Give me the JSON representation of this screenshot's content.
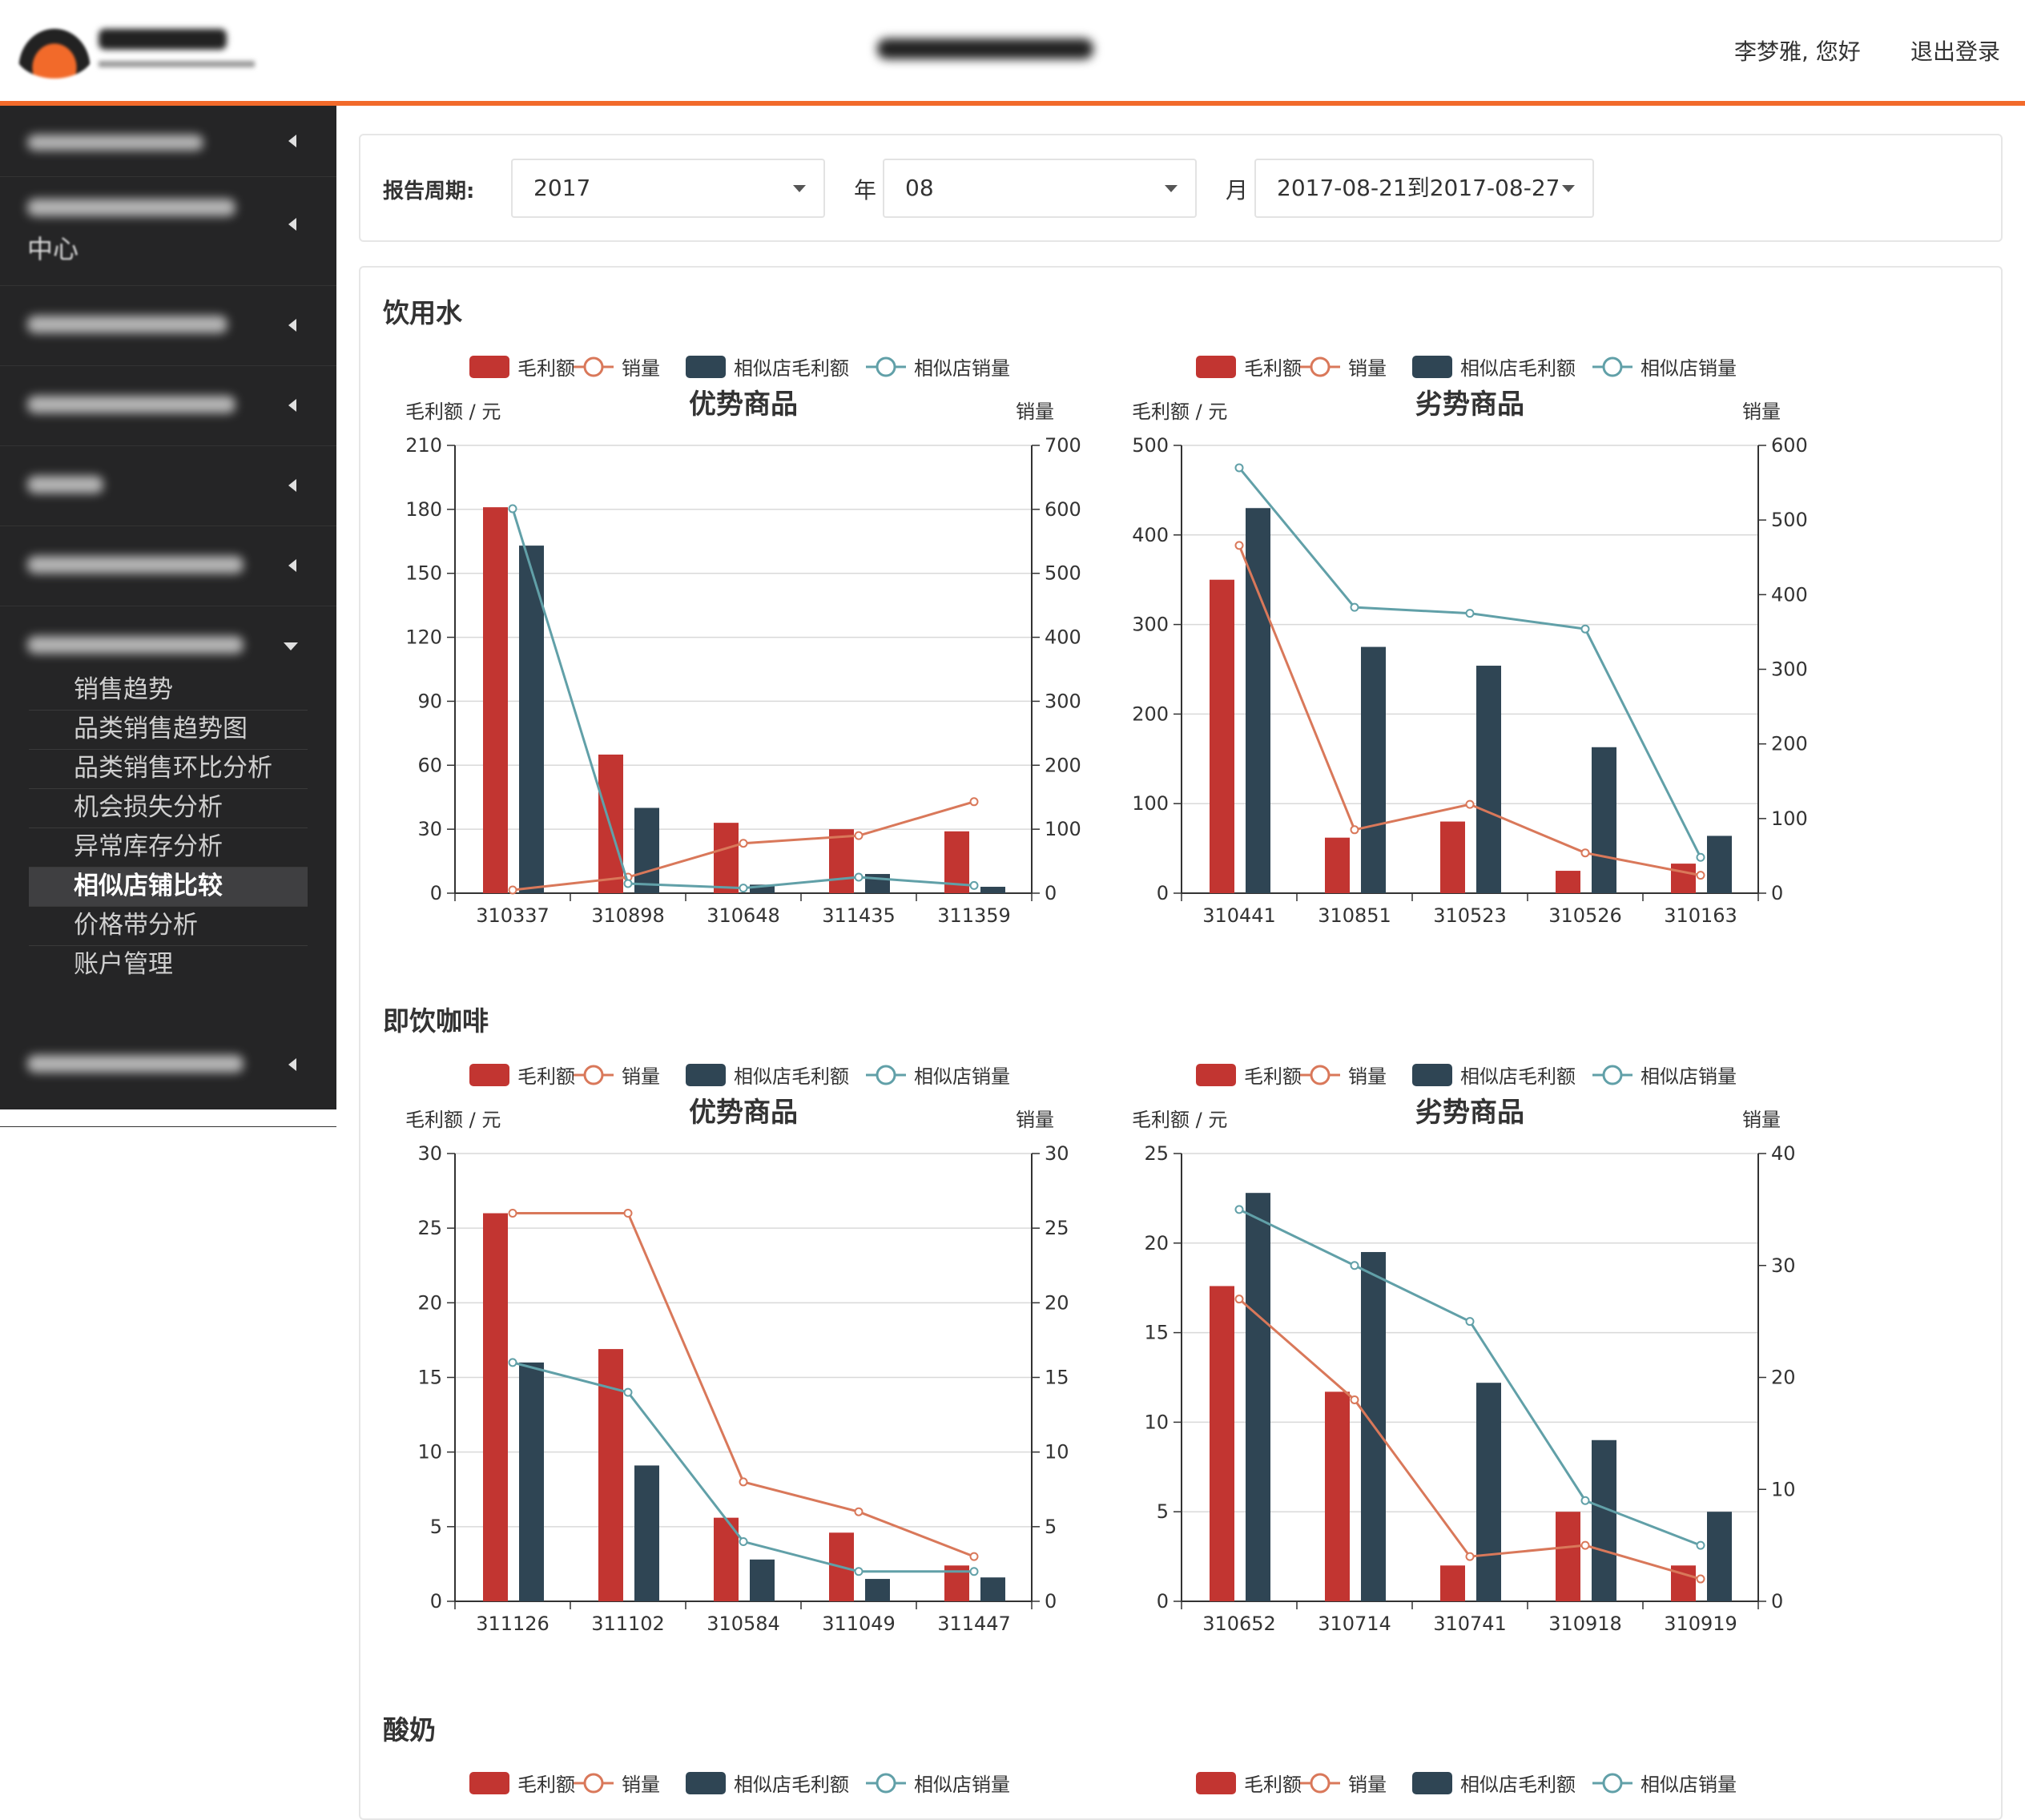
{
  "header": {
    "greeting": "李梦雅, 您好",
    "logout": "退出登录"
  },
  "sidebar": {
    "submenu": [
      {
        "label": "销售趋势",
        "active": false
      },
      {
        "label": "品类销售趋势图",
        "active": false
      },
      {
        "label": "品类销售环比分析",
        "active": false
      },
      {
        "label": "机会损失分析",
        "active": false
      },
      {
        "label": "异常库存分析",
        "active": false
      },
      {
        "label": "相似店铺比较",
        "active": true
      },
      {
        "label": "价格带分析",
        "active": false
      },
      {
        "label": "账户管理",
        "active": false
      }
    ],
    "second_item_text": "中心"
  },
  "filters": {
    "period_label": "报告周期:",
    "year": "2017",
    "year_unit": "年",
    "month": "08",
    "month_unit": "月",
    "week": "2017-08-21到2017-08-27"
  },
  "colors": {
    "profit": "#c23531",
    "sales": "#d9785a",
    "similar_profit": "#2f4554",
    "similar_sales": "#61a0a8",
    "accent": "#f26a2a"
  },
  "legend": [
    "毛利额",
    "销量",
    "相似店毛利额",
    "相似店销量"
  ],
  "axis_labels": {
    "left": "毛利额 / 元",
    "right": "销量"
  },
  "sections": [
    {
      "title": "饮用水"
    },
    {
      "title": "即饮咖啡"
    },
    {
      "title": "酸奶"
    }
  ],
  "chart_data": [
    {
      "type": "bar",
      "section": "饮用水",
      "title": "优势商品",
      "categories": [
        "310337",
        "310898",
        "310648",
        "311435",
        "311359"
      ],
      "ylabel": "毛利额 / 元",
      "ylim": [
        0,
        210
      ],
      "yticks": [
        0,
        30,
        60,
        90,
        120,
        150,
        180,
        210
      ],
      "y2label": "销量",
      "y2lim": [
        0,
        700
      ],
      "y2ticks": [
        0,
        100,
        200,
        300,
        400,
        500,
        600,
        700
      ],
      "series": [
        {
          "name": "毛利额",
          "type": "bar",
          "axis": "left",
          "values": [
            181,
            65,
            33,
            30,
            29
          ]
        },
        {
          "name": "相似店毛利额",
          "type": "bar",
          "axis": "left",
          "values": [
            163,
            40,
            4,
            9,
            3
          ]
        },
        {
          "name": "销量",
          "type": "line",
          "axis": "right",
          "values": [
            5,
            25,
            78,
            90,
            143
          ]
        },
        {
          "name": "相似店销量",
          "type": "line",
          "axis": "right",
          "values": [
            601,
            15,
            8,
            25,
            12
          ]
        }
      ]
    },
    {
      "type": "bar",
      "section": "饮用水",
      "title": "劣势商品",
      "categories": [
        "310441",
        "310851",
        "310523",
        "310526",
        "310163"
      ],
      "ylabel": "毛利额 / 元",
      "ylim": [
        0,
        500
      ],
      "yticks": [
        0,
        100,
        200,
        300,
        400,
        500
      ],
      "y2label": "销量",
      "y2lim": [
        0,
        600
      ],
      "y2ticks": [
        0,
        100,
        200,
        300,
        400,
        500,
        600
      ],
      "series": [
        {
          "name": "毛利额",
          "type": "bar",
          "axis": "left",
          "values": [
            350,
            62,
            80,
            25,
            33
          ]
        },
        {
          "name": "相似店毛利额",
          "type": "bar",
          "axis": "left",
          "values": [
            430,
            275,
            254,
            163,
            64
          ]
        },
        {
          "name": "销量",
          "type": "line",
          "axis": "right",
          "values": [
            466,
            85,
            119,
            54,
            24
          ]
        },
        {
          "name": "相似店销量",
          "type": "line",
          "axis": "right",
          "values": [
            570,
            383,
            375,
            354,
            48
          ]
        }
      ]
    },
    {
      "type": "bar",
      "section": "即饮咖啡",
      "title": "优势商品",
      "categories": [
        "311126",
        "311102",
        "310584",
        "311049",
        "311447"
      ],
      "ylabel": "毛利额 / 元",
      "ylim": [
        0,
        30
      ],
      "yticks": [
        0,
        5,
        10,
        15,
        20,
        25,
        30
      ],
      "y2label": "销量",
      "y2lim": [
        0,
        30
      ],
      "y2ticks": [
        0,
        5,
        10,
        15,
        20,
        25,
        30
      ],
      "series": [
        {
          "name": "毛利额",
          "type": "bar",
          "axis": "left",
          "values": [
            26,
            16.9,
            5.6,
            4.6,
            2.4
          ]
        },
        {
          "name": "相似店毛利额",
          "type": "bar",
          "axis": "left",
          "values": [
            16,
            9.1,
            2.8,
            1.5,
            1.6
          ]
        },
        {
          "name": "销量",
          "type": "line",
          "axis": "right",
          "values": [
            26,
            26,
            8,
            6,
            3
          ]
        },
        {
          "name": "相似店销量",
          "type": "line",
          "axis": "right",
          "values": [
            16,
            14,
            4,
            2,
            2
          ]
        }
      ]
    },
    {
      "type": "bar",
      "section": "即饮咖啡",
      "title": "劣势商品",
      "categories": [
        "310652",
        "310714",
        "310741",
        "310918",
        "310919"
      ],
      "ylabel": "毛利额 / 元",
      "ylim": [
        0,
        25
      ],
      "yticks": [
        0,
        5,
        10,
        15,
        20,
        25
      ],
      "y2label": "销量",
      "y2lim": [
        0,
        40
      ],
      "y2ticks": [
        0,
        10,
        20,
        30,
        40
      ],
      "series": [
        {
          "name": "毛利额",
          "type": "bar",
          "axis": "left",
          "values": [
            17.6,
            11.7,
            2,
            5,
            2
          ]
        },
        {
          "name": "相似店毛利额",
          "type": "bar",
          "axis": "left",
          "values": [
            22.8,
            19.5,
            12.2,
            9,
            5
          ]
        },
        {
          "name": "销量",
          "type": "line",
          "axis": "right",
          "values": [
            27,
            18,
            4,
            5,
            2
          ]
        },
        {
          "name": "相似店销量",
          "type": "line",
          "axis": "right",
          "values": [
            35,
            30,
            25,
            9,
            5
          ]
        }
      ]
    }
  ]
}
